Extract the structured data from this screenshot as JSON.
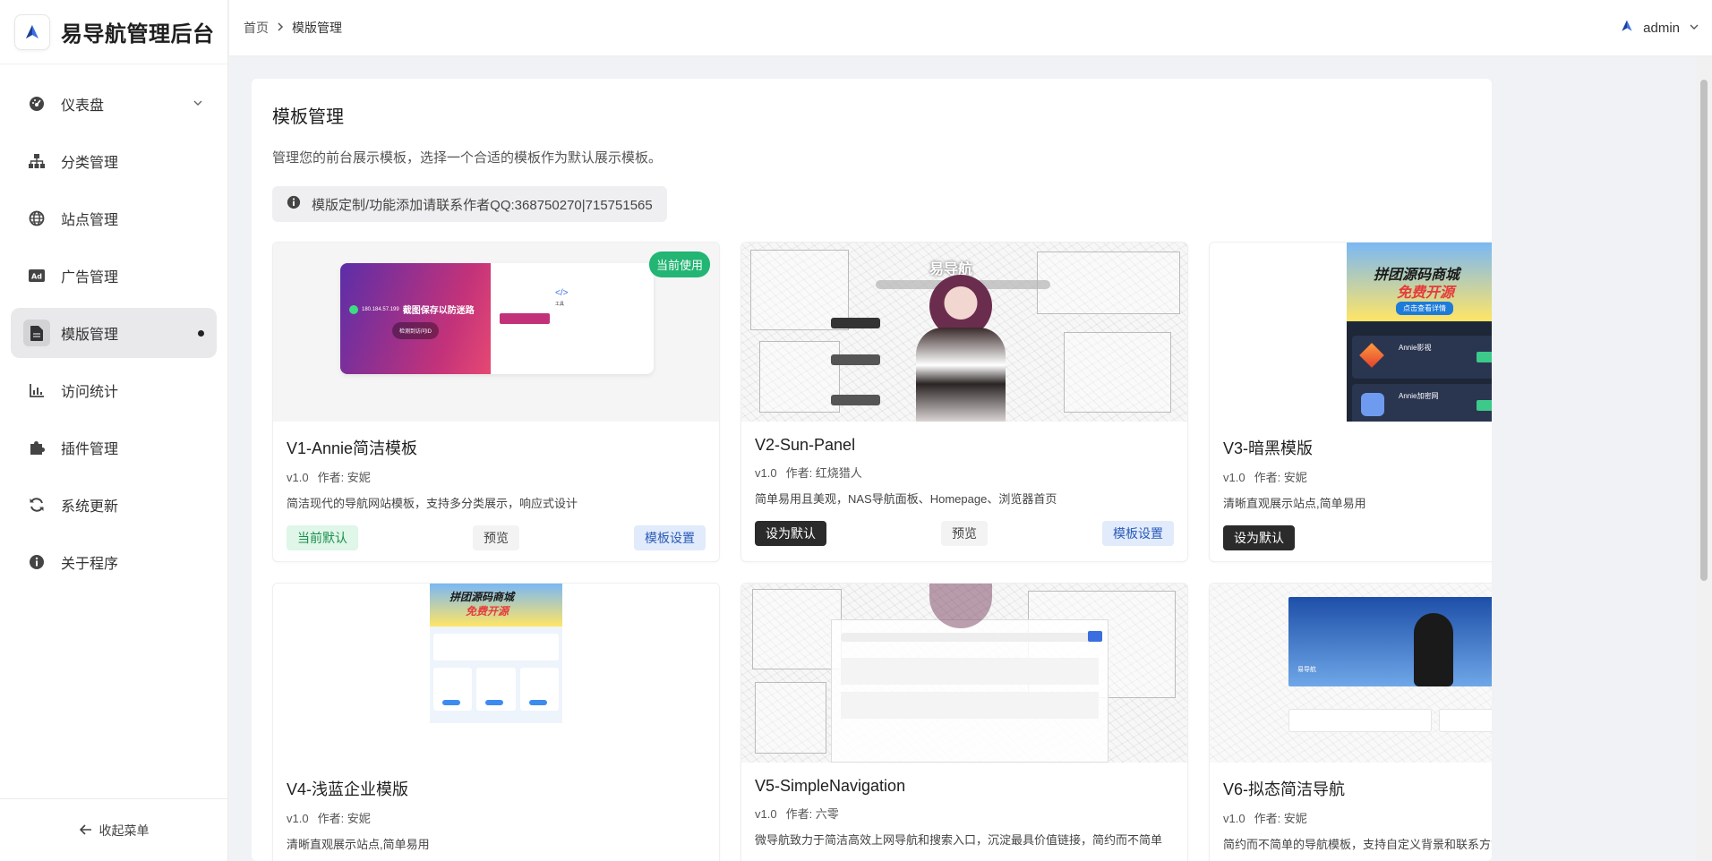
{
  "brand": {
    "title": "易导航管理后台"
  },
  "sidebar": {
    "items": [
      {
        "label": "仪表盘",
        "icon": "dashboard-icon"
      },
      {
        "label": "分类管理",
        "icon": "sitemap-icon"
      },
      {
        "label": "站点管理",
        "icon": "globe-icon"
      },
      {
        "label": "广告管理",
        "icon": "ad-icon"
      },
      {
        "label": "模版管理",
        "icon": "file-icon"
      },
      {
        "label": "访问统计",
        "icon": "bar-chart-icon"
      },
      {
        "label": "插件管理",
        "icon": "puzzle-icon"
      },
      {
        "label": "系统更新",
        "icon": "refresh-icon"
      },
      {
        "label": "关于程序",
        "icon": "info-icon"
      }
    ],
    "collapse_label": "收起菜单"
  },
  "header": {
    "breadcrumb": {
      "home": "首页",
      "current": "模版管理"
    },
    "user": "admin"
  },
  "main": {
    "title": "模板管理",
    "description": "管理您的前台展示模板，选择一个合适的模板作为默认展示模板。",
    "notice": "模版定制/功能添加请联系作者QQ:368750270|715751565",
    "current_badge": "当前使用",
    "version_prefix": "v1.0",
    "buttons": {
      "current": "当前默认",
      "set_default": "设为默认",
      "preview": "预览",
      "settings": "模板设置"
    },
    "templates": [
      {
        "name": "V1-Annie简洁模板",
        "version": "v1.0",
        "author": "作者: 安妮",
        "desc": "简洁现代的导航网站模板，支持多分类展示，响应式设计"
      },
      {
        "name": "V2-Sun-Panel",
        "version": "v1.0",
        "author": "作者: 红烧猎人",
        "desc": "简单易用且美观，NAS导航面板、Homepage、浏览器首页"
      },
      {
        "name": "V3-暗黑模版",
        "version": "v1.0",
        "author": "作者: 安妮",
        "desc": "清晰直观展示站点,简单易用"
      },
      {
        "name": "V4-浅蓝企业模版",
        "version": "v1.0",
        "author": "作者: 安妮",
        "desc": "清晰直观展示站点,简单易用"
      },
      {
        "name": "V5-SimpleNavigation",
        "version": "v1.0",
        "author": "作者: 六零",
        "desc": "微导航致力于简洁高效上网导航和搜索入口，沉淀最具价值链接，简约而不简单"
      },
      {
        "name": "V6-拟态简洁导航",
        "version": "v1.0",
        "author": "作者: 安妮",
        "desc": "简约而不简单的导航模板，支持自定义背景和联系方式"
      }
    ],
    "thumb_text": {
      "v1_main": "截图保存以防迷路",
      "v1_ip": "180.184.57.199",
      "v1_btn": "检测到访问ID",
      "v1_right": "工具",
      "v2_logo": "易导航",
      "v3_banner_1": "拼团源码商城",
      "v3_banner_2": "免费开源",
      "v3_banner_3": "点击查看详情",
      "v3_item_1": "Annie影视",
      "v3_item_2": "Annie加密网",
      "v4_banner_1": "拼团源码商城",
      "v4_banner_2": "免费开源",
      "v6_title": "易导航"
    }
  },
  "colors": {
    "accent_green": "#22b573",
    "dark_button": "#2b2b2b",
    "blue_button_bg": "#e1ebfb"
  }
}
